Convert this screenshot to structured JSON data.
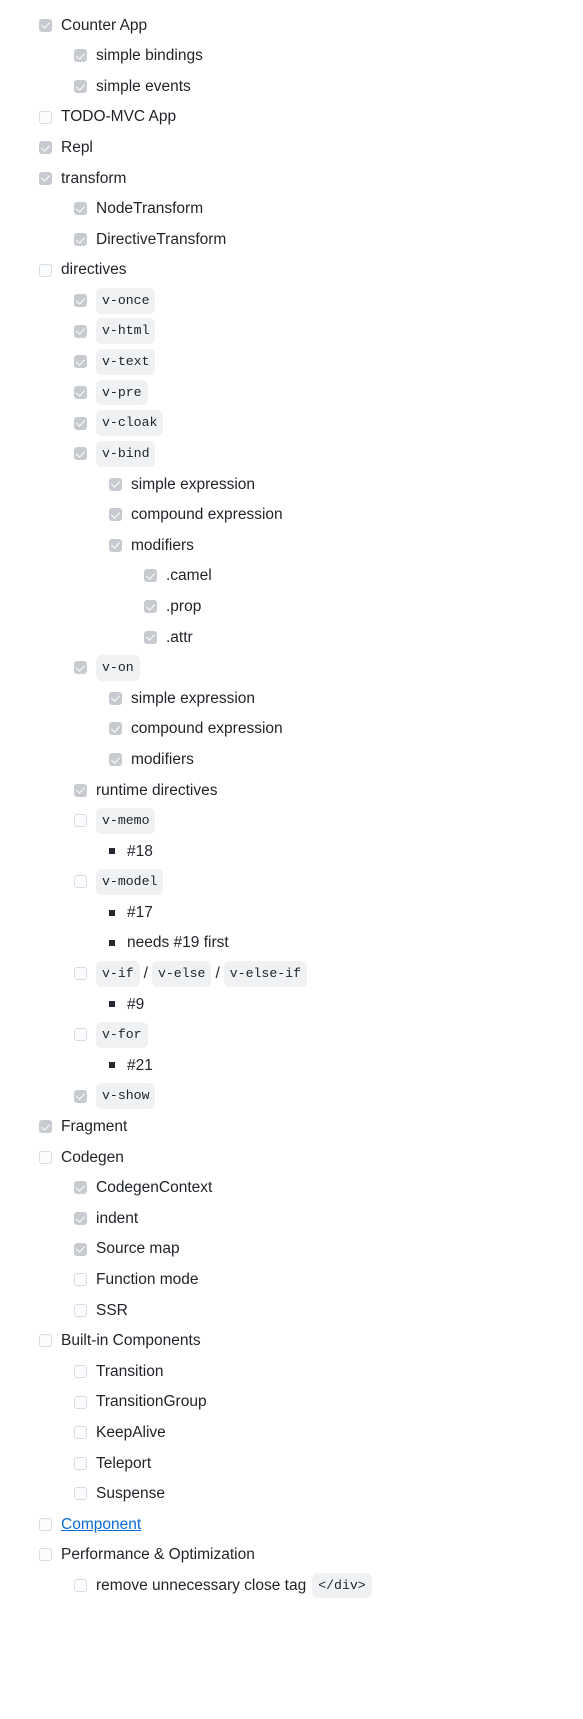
{
  "document": {
    "kind": "markdown-task-list",
    "colors": {
      "text": "#1F2328",
      "link": "#0969da",
      "code_background": "#eff1f3",
      "checkbox_checked": "#c7cbd0",
      "checkbox_unchecked_border": "#d9dde1",
      "page_background": "#ffffff"
    },
    "items": [
      {
        "level": 0,
        "marker": "checkbox",
        "checked": true,
        "parts": [
          {
            "type": "text",
            "value": "Counter App"
          }
        ]
      },
      {
        "level": 1,
        "marker": "checkbox",
        "checked": true,
        "parts": [
          {
            "type": "text",
            "value": "simple bindings"
          }
        ]
      },
      {
        "level": 1,
        "marker": "checkbox",
        "checked": true,
        "parts": [
          {
            "type": "text",
            "value": "simple events"
          }
        ]
      },
      {
        "level": 0,
        "marker": "checkbox",
        "checked": false,
        "parts": [
          {
            "type": "text",
            "value": "TODO-MVC App"
          }
        ]
      },
      {
        "level": 0,
        "marker": "checkbox",
        "checked": true,
        "parts": [
          {
            "type": "text",
            "value": "Repl"
          }
        ]
      },
      {
        "level": 0,
        "marker": "checkbox",
        "checked": true,
        "parts": [
          {
            "type": "text",
            "value": "transform"
          }
        ]
      },
      {
        "level": 1,
        "marker": "checkbox",
        "checked": true,
        "parts": [
          {
            "type": "text",
            "value": "NodeTransform"
          }
        ]
      },
      {
        "level": 1,
        "marker": "checkbox",
        "checked": true,
        "parts": [
          {
            "type": "text",
            "value": "DirectiveTransform"
          }
        ]
      },
      {
        "level": 0,
        "marker": "checkbox",
        "checked": false,
        "parts": [
          {
            "type": "text",
            "value": "directives"
          }
        ]
      },
      {
        "level": 1,
        "marker": "checkbox",
        "checked": true,
        "parts": [
          {
            "type": "code",
            "value": "v-once"
          }
        ]
      },
      {
        "level": 1,
        "marker": "checkbox",
        "checked": true,
        "parts": [
          {
            "type": "code",
            "value": "v-html"
          }
        ]
      },
      {
        "level": 1,
        "marker": "checkbox",
        "checked": true,
        "parts": [
          {
            "type": "code",
            "value": "v-text"
          }
        ]
      },
      {
        "level": 1,
        "marker": "checkbox",
        "checked": true,
        "parts": [
          {
            "type": "code",
            "value": "v-pre"
          }
        ]
      },
      {
        "level": 1,
        "marker": "checkbox",
        "checked": true,
        "parts": [
          {
            "type": "code",
            "value": "v-cloak"
          }
        ]
      },
      {
        "level": 1,
        "marker": "checkbox",
        "checked": true,
        "parts": [
          {
            "type": "code",
            "value": "v-bind"
          }
        ]
      },
      {
        "level": 2,
        "marker": "checkbox",
        "checked": true,
        "parts": [
          {
            "type": "text",
            "value": "simple expression"
          }
        ]
      },
      {
        "level": 2,
        "marker": "checkbox",
        "checked": true,
        "parts": [
          {
            "type": "text",
            "value": "compound expression"
          }
        ]
      },
      {
        "level": 2,
        "marker": "checkbox",
        "checked": true,
        "parts": [
          {
            "type": "text",
            "value": "modifiers"
          }
        ]
      },
      {
        "level": 3,
        "marker": "checkbox",
        "checked": true,
        "parts": [
          {
            "type": "text",
            "value": ".camel"
          }
        ]
      },
      {
        "level": 3,
        "marker": "checkbox",
        "checked": true,
        "parts": [
          {
            "type": "text",
            "value": ".prop"
          }
        ]
      },
      {
        "level": 3,
        "marker": "checkbox",
        "checked": true,
        "parts": [
          {
            "type": "text",
            "value": ".attr"
          }
        ]
      },
      {
        "level": 1,
        "marker": "checkbox",
        "checked": true,
        "parts": [
          {
            "type": "code",
            "value": "v-on"
          }
        ]
      },
      {
        "level": 2,
        "marker": "checkbox",
        "checked": true,
        "parts": [
          {
            "type": "text",
            "value": "simple expression"
          }
        ]
      },
      {
        "level": 2,
        "marker": "checkbox",
        "checked": true,
        "parts": [
          {
            "type": "text",
            "value": "compound expression"
          }
        ]
      },
      {
        "level": 2,
        "marker": "checkbox",
        "checked": true,
        "parts": [
          {
            "type": "text",
            "value": "modifiers"
          }
        ]
      },
      {
        "level": 1,
        "marker": "checkbox",
        "checked": true,
        "parts": [
          {
            "type": "text",
            "value": "runtime directives"
          }
        ]
      },
      {
        "level": 1,
        "marker": "checkbox",
        "checked": false,
        "parts": [
          {
            "type": "code",
            "value": "v-memo"
          }
        ]
      },
      {
        "level": 2,
        "marker": "bullet",
        "checked": null,
        "parts": [
          {
            "type": "text",
            "value": "#18"
          }
        ]
      },
      {
        "level": 1,
        "marker": "checkbox",
        "checked": false,
        "parts": [
          {
            "type": "code",
            "value": "v-model"
          }
        ]
      },
      {
        "level": 2,
        "marker": "bullet",
        "checked": null,
        "parts": [
          {
            "type": "text",
            "value": "#17"
          }
        ]
      },
      {
        "level": 2,
        "marker": "bullet",
        "checked": null,
        "parts": [
          {
            "type": "text",
            "value": "needs #19 first"
          }
        ]
      },
      {
        "level": 1,
        "marker": "checkbox",
        "checked": false,
        "parts": [
          {
            "type": "code",
            "value": "v-if"
          },
          {
            "type": "sep",
            "value": "/"
          },
          {
            "type": "code",
            "value": "v-else"
          },
          {
            "type": "sep",
            "value": "/"
          },
          {
            "type": "code",
            "value": "v-else-if"
          }
        ]
      },
      {
        "level": 2,
        "marker": "bullet",
        "checked": null,
        "parts": [
          {
            "type": "text",
            "value": "#9"
          }
        ]
      },
      {
        "level": 1,
        "marker": "checkbox",
        "checked": false,
        "parts": [
          {
            "type": "code",
            "value": "v-for"
          }
        ]
      },
      {
        "level": 2,
        "marker": "bullet",
        "checked": null,
        "parts": [
          {
            "type": "text",
            "value": "#21"
          }
        ]
      },
      {
        "level": 1,
        "marker": "checkbox",
        "checked": true,
        "parts": [
          {
            "type": "code",
            "value": "v-show"
          }
        ]
      },
      {
        "level": 0,
        "marker": "checkbox",
        "checked": true,
        "parts": [
          {
            "type": "text",
            "value": "Fragment"
          }
        ]
      },
      {
        "level": 0,
        "marker": "checkbox",
        "checked": false,
        "parts": [
          {
            "type": "text",
            "value": "Codegen"
          }
        ]
      },
      {
        "level": 1,
        "marker": "checkbox",
        "checked": true,
        "parts": [
          {
            "type": "text",
            "value": "CodegenContext"
          }
        ]
      },
      {
        "level": 1,
        "marker": "checkbox",
        "checked": true,
        "parts": [
          {
            "type": "text",
            "value": "indent"
          }
        ]
      },
      {
        "level": 1,
        "marker": "checkbox",
        "checked": true,
        "parts": [
          {
            "type": "text",
            "value": "Source map"
          }
        ]
      },
      {
        "level": 1,
        "marker": "checkbox",
        "checked": false,
        "parts": [
          {
            "type": "text",
            "value": "Function mode"
          }
        ]
      },
      {
        "level": 1,
        "marker": "checkbox",
        "checked": false,
        "parts": [
          {
            "type": "text",
            "value": "SSR"
          }
        ]
      },
      {
        "level": 0,
        "marker": "checkbox",
        "checked": false,
        "parts": [
          {
            "type": "text",
            "value": "Built-in Components"
          }
        ]
      },
      {
        "level": 1,
        "marker": "checkbox",
        "checked": false,
        "parts": [
          {
            "type": "text",
            "value": "Transition"
          }
        ]
      },
      {
        "level": 1,
        "marker": "checkbox",
        "checked": false,
        "parts": [
          {
            "type": "text",
            "value": "TransitionGroup"
          }
        ]
      },
      {
        "level": 1,
        "marker": "checkbox",
        "checked": false,
        "parts": [
          {
            "type": "text",
            "value": "KeepAlive"
          }
        ]
      },
      {
        "level": 1,
        "marker": "checkbox",
        "checked": false,
        "parts": [
          {
            "type": "text",
            "value": "Teleport"
          }
        ]
      },
      {
        "level": 1,
        "marker": "checkbox",
        "checked": false,
        "parts": [
          {
            "type": "text",
            "value": "Suspense"
          }
        ]
      },
      {
        "level": 0,
        "marker": "checkbox",
        "checked": false,
        "parts": [
          {
            "type": "link",
            "value": "Component"
          }
        ]
      },
      {
        "level": 0,
        "marker": "checkbox",
        "checked": false,
        "parts": [
          {
            "type": "text",
            "value": "Performance & Optimization"
          }
        ]
      },
      {
        "level": 1,
        "marker": "checkbox",
        "checked": false,
        "parts": [
          {
            "type": "text",
            "value": "remove unnecessary close tag"
          },
          {
            "type": "gap",
            "value": " "
          },
          {
            "type": "code",
            "value": "</div>"
          }
        ]
      }
    ]
  }
}
